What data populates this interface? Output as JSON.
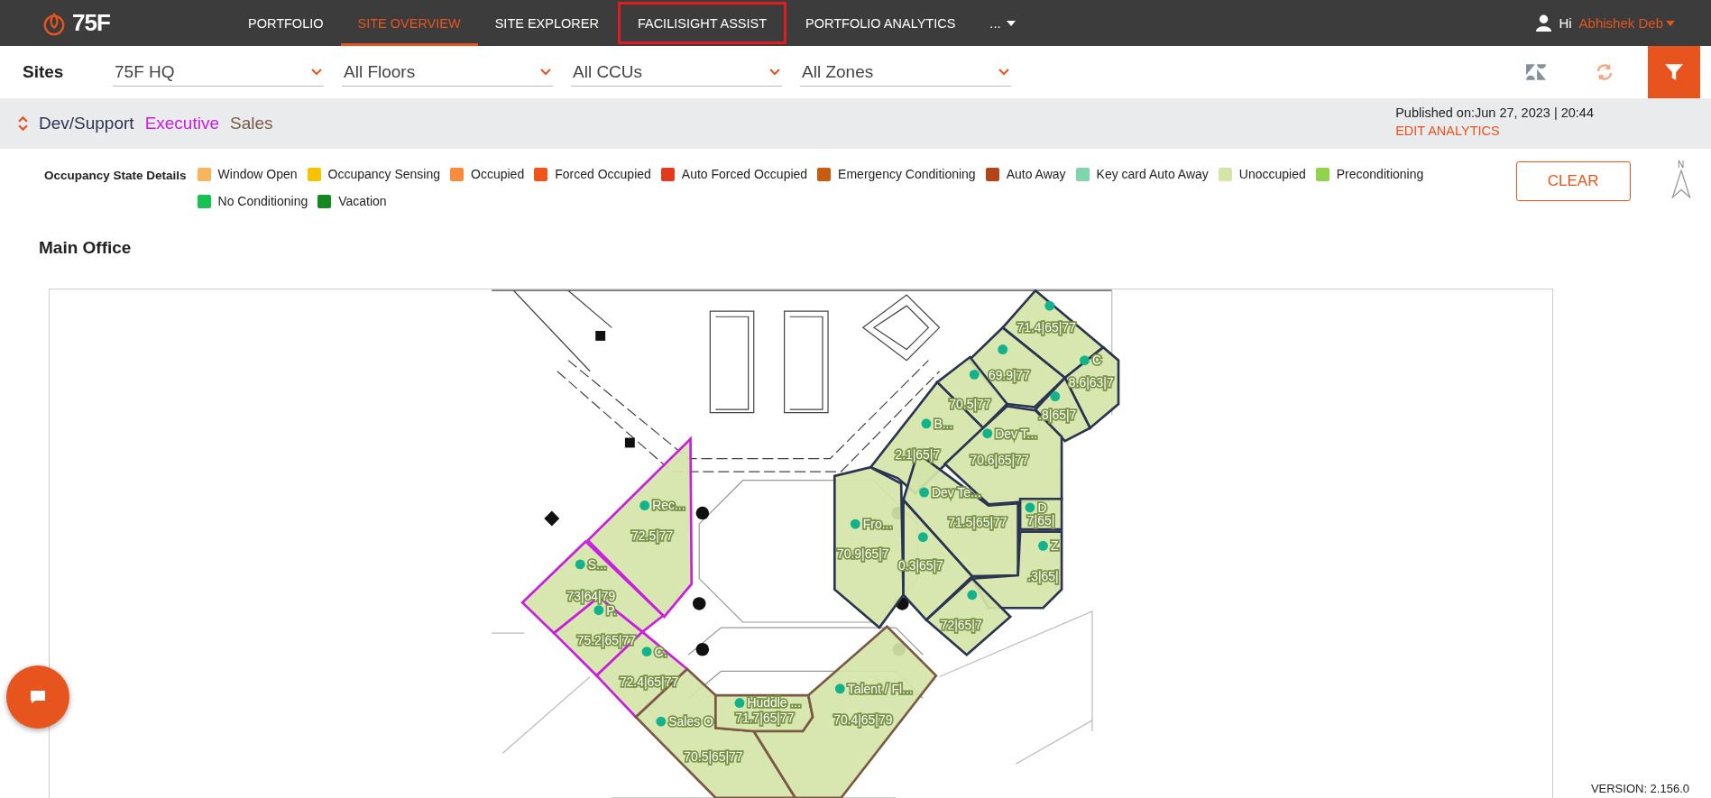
{
  "logo": {
    "text": "75F"
  },
  "nav": [
    {
      "label": "PORTFOLIO",
      "selected": false,
      "highlighted": false
    },
    {
      "label": "SITE OVERVIEW",
      "selected": true,
      "highlighted": false
    },
    {
      "label": "SITE EXPLORER",
      "selected": false,
      "highlighted": false
    },
    {
      "label": "FACILISIGHT ASSIST",
      "selected": false,
      "highlighted": true
    },
    {
      "label": "PORTFOLIO ANALYTICS",
      "selected": false,
      "highlighted": false
    },
    {
      "label": "...",
      "selected": false,
      "highlighted": false
    }
  ],
  "user": {
    "greeting": "Hi",
    "name": "Abhishek Deb"
  },
  "filters": {
    "label": "Sites",
    "dropdowns": [
      "75F HQ",
      "All Floors",
      "All CCUs",
      "All Zones"
    ]
  },
  "departments": [
    {
      "name": "Dev/Support",
      "color": "#2b3450",
      "zones": [
        {
          "reading": "71.4|65|77"
        },
        {
          "reading": "69.9|77"
        },
        {
          "name": "C",
          "reading": "8.6|63|7"
        },
        {
          "reading": ".8|65|7"
        },
        {
          "reading": "70.5|77"
        },
        {
          "name": "B...",
          "reading": "2.1|65|7"
        },
        {
          "name": "Dev T...",
          "reading": "70.6|65|77"
        },
        {
          "name": "Fro...",
          "reading": "70.9|65|7"
        },
        {
          "name": "Dev Te...",
          "reading": "71.5|65|77"
        },
        {
          "reading": "0.3|65|7"
        },
        {
          "name": "D",
          "reading": "7|65|"
        },
        {
          "name": "Z",
          "reading": ".3|65|"
        },
        {
          "reading": "72|65|7"
        }
      ]
    },
    {
      "name": "Executive",
      "color": "#c81ee0",
      "zones": [
        {
          "name": "Rec...",
          "reading": "72.5|77"
        },
        {
          "name": "S...",
          "reading": "73|64|79"
        },
        {
          "name": "P.",
          "reading": "75.2|65|77"
        },
        {
          "name": "C.",
          "reading": "72.4|65|77"
        }
      ]
    },
    {
      "name": "Sales",
      "color": "#7a5a45",
      "zones": [
        {
          "name": "Sales O",
          "reading": "70.5|65|77"
        },
        {
          "name": "Huddle ...",
          "reading": "71.7|65|77"
        },
        {
          "name": "Talent / Fl...",
          "reading": "70.4|65|79"
        }
      ]
    }
  ],
  "published": {
    "text": "Published on:Jun 27, 2023 | 20:44",
    "link": "EDIT ANALYTICS"
  },
  "legend": {
    "title": "Occupancy State Details",
    "items": [
      {
        "label": "Window Open",
        "color": "#f8b45c"
      },
      {
        "label": "Occupancy Sensing",
        "color": "#f7c200"
      },
      {
        "label": "Occupied",
        "color": "#f98c3c"
      },
      {
        "label": "Forced Occupied",
        "color": "#f2531a"
      },
      {
        "label": "Auto Forced Occupied",
        "color": "#e13a1e"
      },
      {
        "label": "Emergency Conditioning",
        "color": "#c95b10"
      },
      {
        "label": "Auto Away",
        "color": "#b2441a"
      },
      {
        "label": "Key card Auto Away",
        "color": "#7fd6ab"
      },
      {
        "label": "Unoccupied",
        "color": "#d4e5a6"
      },
      {
        "label": "Preconditioning",
        "color": "#8fd24c"
      },
      {
        "label": "No Conditioning",
        "color": "#17c152"
      },
      {
        "label": "Vacation",
        "color": "#13891f"
      }
    ],
    "clear": "CLEAR"
  },
  "compass": "N",
  "floor": {
    "title": "Main Office"
  },
  "version": "VERSION: 2.156.0"
}
